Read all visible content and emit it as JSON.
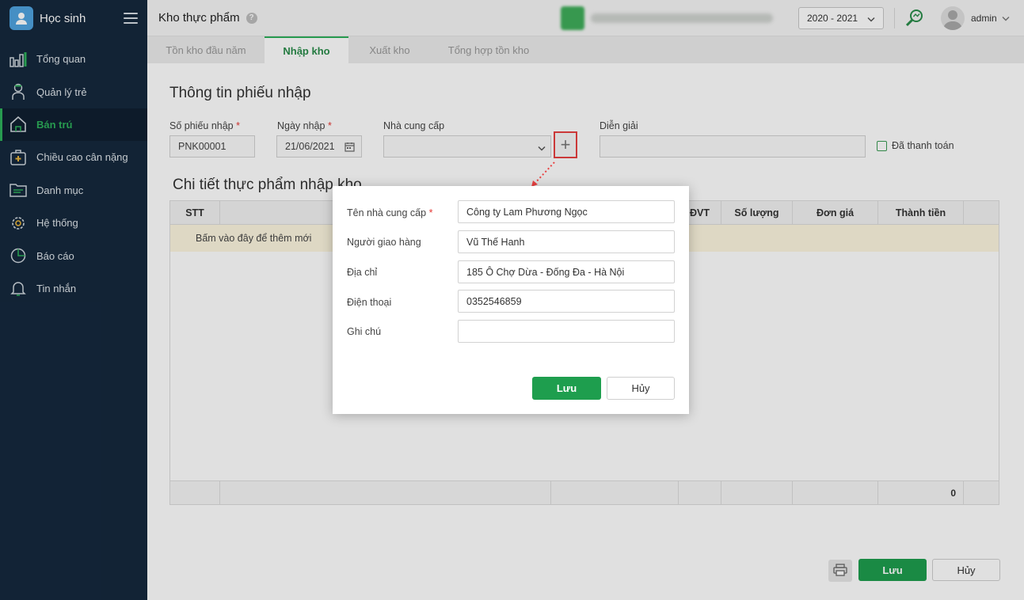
{
  "sidebar": {
    "title": "Học sinh",
    "items": [
      {
        "label": "Tổng quan",
        "icon": "bar-chart-icon"
      },
      {
        "label": "Quản lý trẻ",
        "icon": "child-icon"
      },
      {
        "label": "Bán trú",
        "icon": "house-icon"
      },
      {
        "label": "Chiều cao cân nặng",
        "icon": "health-kit-icon"
      },
      {
        "label": "Danh mục",
        "icon": "folder-icon"
      },
      {
        "label": "Hệ thống",
        "icon": "gear-icon"
      },
      {
        "label": "Báo cáo",
        "icon": "pie-chart-icon"
      },
      {
        "label": "Tin nhắn",
        "icon": "bell-icon"
      }
    ],
    "active_index": 2
  },
  "header": {
    "title": "Kho thực phẩm",
    "help_symbol": "?",
    "year": "2020 - 2021",
    "user": "admin"
  },
  "tabs": [
    "Tồn kho đầu năm",
    "Nhập kho",
    "Xuất kho",
    "Tổng hợp tồn kho"
  ],
  "active_tab": 1,
  "form": {
    "section_title": "Thông tin phiếu nhập",
    "receipt_no_label": "Số phiếu nhập",
    "receipt_no": "PNK00001",
    "date_label": "Ngày nhập",
    "date": "21/06/2021",
    "supplier_label": "Nhà cung cấp",
    "supplier_value": "",
    "add_symbol": "+",
    "description_label": "Diễn giải",
    "description_value": "",
    "paid_label": "Đã thanh toán",
    "required_mark": "*"
  },
  "details": {
    "section_title": "Chi tiết thực phẩm nhập kho",
    "columns": [
      "STT",
      "ĐVT",
      "Số lượng",
      "Đơn giá",
      "Thành tiền"
    ],
    "add_row_text": "Bấm vào đây để thêm mới",
    "total": "0"
  },
  "actions": {
    "save": "Lưu",
    "cancel": "Hủy"
  },
  "modal": {
    "fields": [
      {
        "label": "Tên nhà cung cấp",
        "value": "Công ty Lam Phương Ngọc",
        "required": true
      },
      {
        "label": "Người giao hàng",
        "value": "Vũ Thế Hanh",
        "required": false
      },
      {
        "label": "Địa chỉ",
        "value": "185 Ô Chợ Dừa - Đống Đa - Hà Nội",
        "required": false
      },
      {
        "label": "Điện thoại",
        "value": "0352546859",
        "required": false
      },
      {
        "label": "Ghi chú",
        "value": "",
        "required": false
      }
    ],
    "save": "Lưu",
    "cancel": "Hủy"
  },
  "colors": {
    "sidebar_bg": "#15283d",
    "accent_green": "#1e9e4e",
    "required_red": "#e53935",
    "highlight_red": "#e84040"
  }
}
